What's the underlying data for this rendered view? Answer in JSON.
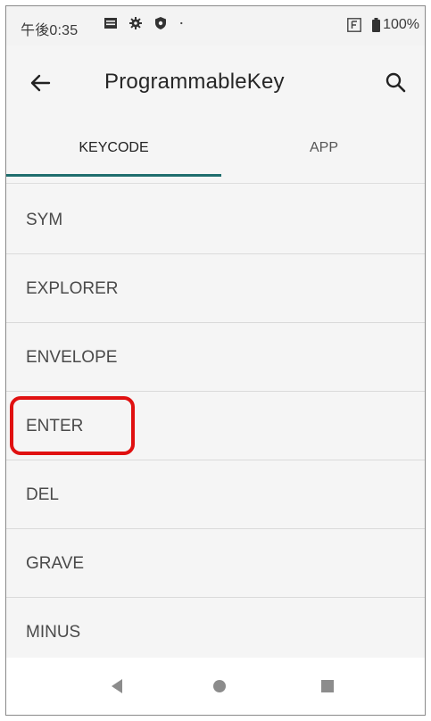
{
  "status_bar": {
    "time": "午後0:35",
    "battery_text": "100%",
    "icons": [
      "message-icon",
      "gear-icon",
      "shield-icon",
      "dot-icon",
      "f-box-icon",
      "battery-icon"
    ]
  },
  "app_bar": {
    "title": "ProgrammableKey",
    "back_icon": "arrow-left-icon",
    "search_icon": "search-icon"
  },
  "tabs": [
    {
      "label": "KEYCODE",
      "selected": true
    },
    {
      "label": "APP",
      "selected": false
    }
  ],
  "list": {
    "items": [
      {
        "label": "SYM"
      },
      {
        "label": "EXPLORER"
      },
      {
        "label": "ENVELOPE"
      },
      {
        "label": "ENTER",
        "highlighted": true
      },
      {
        "label": "DEL"
      },
      {
        "label": "GRAVE"
      },
      {
        "label": "MINUS"
      }
    ]
  },
  "colors": {
    "accent": "#1f6e6e",
    "highlight": "#e01010",
    "background": "#f5f5f5"
  },
  "nav_bar": {
    "icons": [
      "nav-back-icon",
      "nav-home-icon",
      "nav-recent-icon"
    ]
  }
}
